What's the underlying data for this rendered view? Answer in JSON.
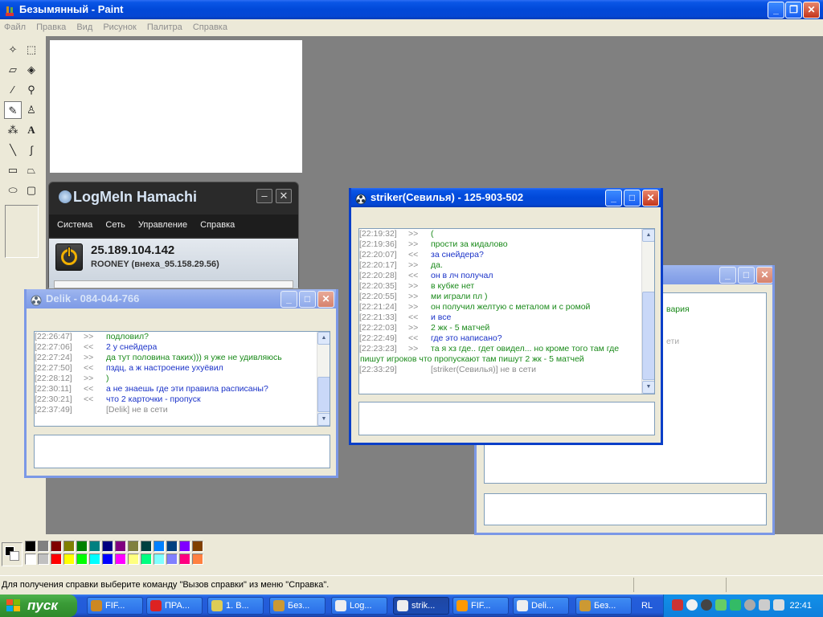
{
  "paint": {
    "title": "Безымянный - Paint",
    "menu": [
      "Файл",
      "Правка",
      "Вид",
      "Рисунок",
      "Палитра",
      "Справка"
    ],
    "status_text": "Для получения справки выберите команду \"Вызов справки\" из меню \"Справка\".",
    "palette_top": [
      "#000000",
      "#808080",
      "#800000",
      "#808000",
      "#008000",
      "#008080",
      "#000080",
      "#800080",
      "#808040",
      "#004040",
      "#0080ff",
      "#004080",
      "#8000ff",
      "#804000"
    ],
    "palette_bottom": [
      "#ffffff",
      "#c0c0c0",
      "#ff0000",
      "#ffff00",
      "#00ff00",
      "#00ffff",
      "#0000ff",
      "#ff00ff",
      "#ffff80",
      "#00ff80",
      "#80ffff",
      "#8080ff",
      "#ff0080",
      "#ff8040"
    ]
  },
  "hamachi": {
    "title": "LogMeIn Hamachi",
    "menu": [
      "Система",
      "Сеть",
      "Управление",
      "Справка"
    ],
    "ip": "25.189.104.142",
    "nick": "ROONEY (внеха_95.158.29.56)"
  },
  "chat_delik": {
    "title": "Delik - 084-044-766",
    "messages": [
      {
        "time": "[22:26:47]",
        "dir": ">>",
        "text": "подловил?",
        "kind": "in"
      },
      {
        "time": "[22:27:06]",
        "dir": "<<",
        "text": "2 у снейдера",
        "kind": "out"
      },
      {
        "time": "[22:27:24]",
        "dir": ">>",
        "text": "да тут половина таких))) я уже не удивляюсь",
        "kind": "in"
      },
      {
        "time": "[22:27:50]",
        "dir": "<<",
        "text": "пздц, а ж настроение ухуёвил",
        "kind": "out"
      },
      {
        "time": "[22:28:12]",
        "dir": ">>",
        "text": ")",
        "kind": "in"
      },
      {
        "time": "[22:30:11]",
        "dir": "<<",
        "text": "а не знаешь где эти правила расписаны?",
        "kind": "out"
      },
      {
        "time": "[22:30:21]",
        "dir": "<<",
        "text": "что 2 карточки - пропуск",
        "kind": "out"
      },
      {
        "time": "[22:37:49]",
        "dir": "",
        "text": "[Delik] не в сети",
        "kind": "sys"
      }
    ]
  },
  "chat_striker": {
    "title": "striker(Севилья) - 125-903-502",
    "messages": [
      {
        "time": "[22:19:32]",
        "dir": ">>",
        "text": "(",
        "kind": "in"
      },
      {
        "time": "[22:19:36]",
        "dir": ">>",
        "text": "прости за кидалово",
        "kind": "in"
      },
      {
        "time": "[22:20:07]",
        "dir": "<<",
        "text": "за снейдера?",
        "kind": "out"
      },
      {
        "time": "[22:20:17]",
        "dir": ">>",
        "text": "да.",
        "kind": "in"
      },
      {
        "time": "[22:20:28]",
        "dir": "<<",
        "text": "он в лч получал",
        "kind": "out"
      },
      {
        "time": "[22:20:35]",
        "dir": ">>",
        "text": "в кубке нет",
        "kind": "in"
      },
      {
        "time": "[22:20:55]",
        "dir": ">>",
        "text": "ми играли пл )",
        "kind": "in"
      },
      {
        "time": "[22:21:24]",
        "dir": ">>",
        "text": "он получил желтую с металом и с ромой",
        "kind": "in"
      },
      {
        "time": "[22:21:33]",
        "dir": "<<",
        "text": "и все",
        "kind": "out"
      },
      {
        "time": "[22:22:03]",
        "dir": ">>",
        "text": "2 жк - 5 матчей",
        "kind": "in"
      },
      {
        "time": "[22:22:49]",
        "dir": "<<",
        "text": "где это написано?",
        "kind": "out"
      },
      {
        "time": "[22:23:23]",
        "dir": ">>",
        "text": "та я хз где.. гдет овидел... но кроме того там где",
        "kind": "in"
      },
      {
        "time": "",
        "dir": "",
        "text": "пишут игроков что пропускают там пишут 2 жк - 5 матчей",
        "kind": "in"
      },
      {
        "time": "[22:33:29]",
        "dir": "",
        "text": "[striker(Севилья)] не в сети",
        "kind": "sys"
      }
    ]
  },
  "chat_back": {
    "visible_fragments": [
      "вария",
      "ети"
    ]
  },
  "taskbar": {
    "start_label": "пуск",
    "tasks": [
      "FIF...",
      "ПРА...",
      "1. В...",
      "Без...",
      "Log...",
      "strik...",
      "FIF...",
      "Deli...",
      "Без..."
    ],
    "lang": "RL",
    "clock": "22:41"
  }
}
